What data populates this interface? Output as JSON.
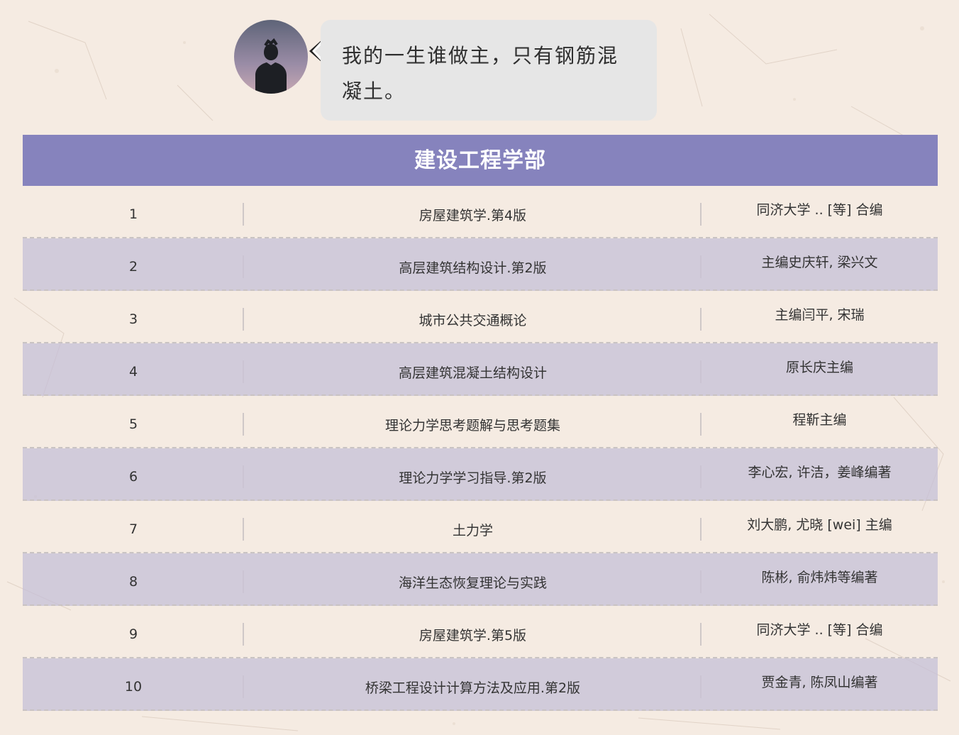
{
  "chat": {
    "message": "我的一生谁做主，只有钢筋混凝土。",
    "avatar_icon": "person-silhouette-icon"
  },
  "table": {
    "title": "建设工程学部",
    "header_color": "#8683bd",
    "rows": [
      {
        "num": "1",
        "title": "房屋建筑学.第4版",
        "author": "同济大学 .. [等] 合编"
      },
      {
        "num": "2",
        "title": "高层建筑结构设计.第2版",
        "author": "主编史庆轩, 梁兴文"
      },
      {
        "num": "3",
        "title": "城市公共交通概论",
        "author": "主编闫平, 宋瑞"
      },
      {
        "num": "4",
        "title": "高层建筑混凝土结构设计",
        "author": "原长庆主编"
      },
      {
        "num": "5",
        "title": "理论力学思考题解与思考题集",
        "author": "程靳主编"
      },
      {
        "num": "6",
        "title": "理论力学学习指导.第2版",
        "author": "李心宏, 许洁，姜峰编著"
      },
      {
        "num": "7",
        "title": "土力学",
        "author": "刘大鹏, 尤晓 [wei] 主编"
      },
      {
        "num": "8",
        "title": "海洋生态恢复理论与实践",
        "author": "陈彬, 俞炜炜等编著"
      },
      {
        "num": "9",
        "title": "房屋建筑学.第5版",
        "author": "同济大学 .. [等] 合编"
      },
      {
        "num": "10",
        "title": "桥梁工程设计计算方法及应用.第2版",
        "author": "贾金青, 陈凤山编著"
      }
    ]
  }
}
